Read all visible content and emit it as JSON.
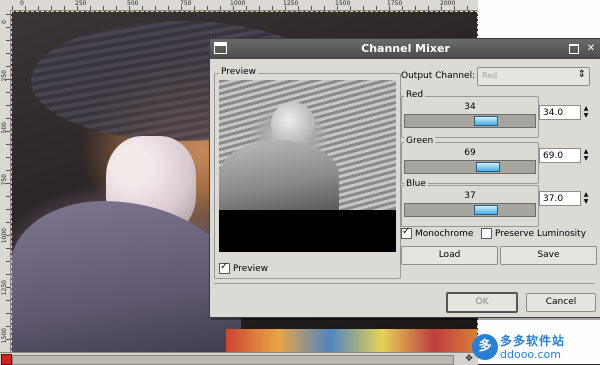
{
  "ruler_top": {
    "ticks": [
      "0",
      "250",
      "500",
      "750",
      "1000",
      "1250",
      "1500",
      "1750",
      "2000"
    ]
  },
  "ruler_left": {
    "ticks": [
      "0",
      "250",
      "500",
      "750",
      "1000",
      "1250",
      "1500"
    ]
  },
  "watermark": {
    "logo": "多",
    "title": "多多软件站",
    "url": "ddooo.com"
  },
  "dialog": {
    "title": "Channel Mixer",
    "preview_label": "Preview",
    "preview_checkbox_label": "Preview",
    "preview_checked": true,
    "output_channel_label": "Output Channel:",
    "output_channel_value": "Red",
    "channels": [
      {
        "name": "Red",
        "value": 34,
        "spin": "34.0",
        "level": 0.62
      },
      {
        "name": "Green",
        "value": 69,
        "spin": "69.0",
        "level": 0.64
      },
      {
        "name": "Blue",
        "value": 37,
        "spin": "37.0",
        "level": 0.62
      }
    ],
    "monochrome_label": "Monochrome",
    "monochrome_checked": true,
    "preserve_luminosity_label": "Preserve Luminosity",
    "preserve_luminosity_checked": false,
    "load_label": "Load",
    "save_label": "Save",
    "ok_label": "OK",
    "cancel_label": "Cancel"
  },
  "icons": [
    "window-menu-icon",
    "maximize-icon",
    "close-icon",
    "dropdown-arrow-icon",
    "spin-arrows-icon",
    "navigate-icon",
    "status-icon"
  ]
}
